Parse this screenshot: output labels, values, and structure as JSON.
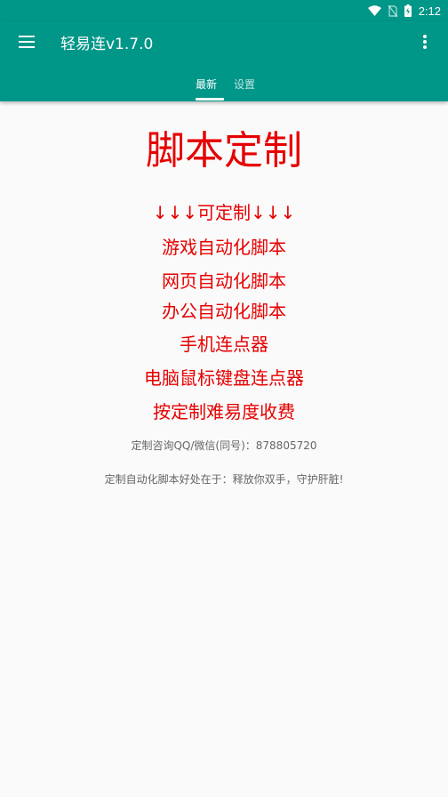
{
  "status_bar": {
    "time": "2:12",
    "icons": [
      "wifi-icon",
      "no-sim-icon",
      "battery-charging-icon"
    ]
  },
  "app_bar": {
    "title": "轻易连v1.7.0",
    "menu_icon": "hamburger-menu-icon",
    "overflow_icon": "more-vert-icon",
    "color": "#009688"
  },
  "tabs": [
    {
      "label": "最新",
      "active": true
    },
    {
      "label": "设置",
      "active": false
    }
  ],
  "main": {
    "headline": "脚本定制",
    "headline_color": "#e60000",
    "features": [
      "↓↓↓可定制↓↓↓",
      "游戏自动化脚本",
      "网页自动化脚本",
      "办公自动化脚本",
      "手机连点器",
      "电脑鼠标键盘连点器",
      "按定制难易度收费"
    ],
    "contact": "定制咨询QQ/微信(同号)：878805720",
    "slogan": "定制自动化脚本好处在于：释放你双手，守护肝脏!"
  }
}
